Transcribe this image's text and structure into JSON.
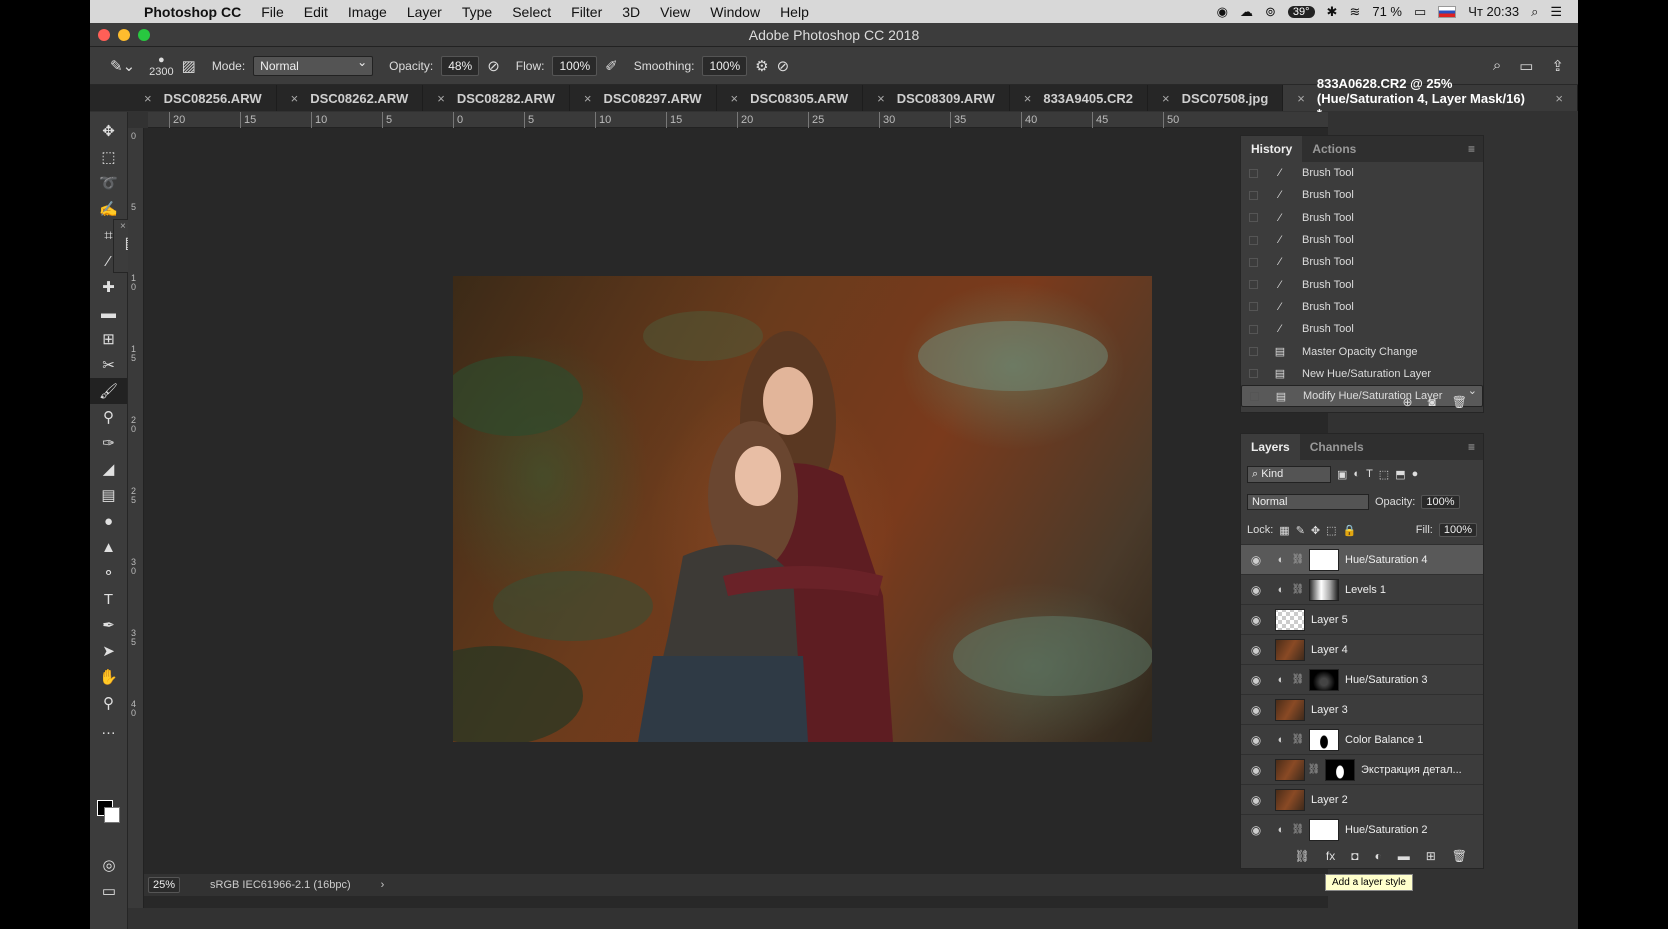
{
  "menubar": {
    "app": "Photoshop CC",
    "items": [
      "File",
      "Edit",
      "Image",
      "Layer",
      "Type",
      "Select",
      "Filter",
      "3D",
      "View",
      "Window",
      "Help"
    ],
    "temp": "39°",
    "battery": "71 %",
    "clock": "Чт 20:33"
  },
  "window": {
    "title": "Adobe Photoshop CC 2018"
  },
  "options": {
    "brush_size": "2300",
    "mode_label": "Mode:",
    "mode_value": "Normal",
    "opacity_label": "Opacity:",
    "opacity_value": "48%",
    "flow_label": "Flow:",
    "flow_value": "100%",
    "smoothing_label": "Smoothing:",
    "smoothing_value": "100%"
  },
  "tabs": [
    "DSC08256.ARW",
    "DSC08262.ARW",
    "DSC08282.ARW",
    "DSC08297.ARW",
    "DSC08305.ARW",
    "DSC08309.ARW",
    "833A9405.CR2",
    "DSC07508.jpg",
    "833A0628.CR2 @ 25% (Hue/Saturation 4, Layer Mask/16) *"
  ],
  "ruler_top": [
    "20",
    "15",
    "10",
    "5",
    "0",
    "5",
    "10",
    "15",
    "20",
    "25",
    "30",
    "35",
    "40",
    "45",
    "50"
  ],
  "ruler_left": [
    "0",
    "5",
    "1\n0",
    "1\n5",
    "2\n0",
    "2\n5",
    "3\n0",
    "3\n5",
    "4\n0"
  ],
  "status": {
    "zoom": "25%",
    "profile": "sRGB IEC61966-2.1 (16bpc)"
  },
  "history": {
    "tabs": [
      "History",
      "Actions"
    ],
    "items": [
      {
        "label": "Brush Tool",
        "icon": "brush-icon"
      },
      {
        "label": "Brush Tool",
        "icon": "brush-icon"
      },
      {
        "label": "Brush Tool",
        "icon": "brush-icon"
      },
      {
        "label": "Brush Tool",
        "icon": "brush-icon"
      },
      {
        "label": "Brush Tool",
        "icon": "brush-icon"
      },
      {
        "label": "Brush Tool",
        "icon": "brush-icon"
      },
      {
        "label": "Brush Tool",
        "icon": "brush-icon"
      },
      {
        "label": "Brush Tool",
        "icon": "brush-icon"
      },
      {
        "label": "Master Opacity Change",
        "icon": "document-icon"
      },
      {
        "label": "New Hue/Saturation Layer",
        "icon": "document-icon"
      },
      {
        "label": "Modify Hue/Saturation Layer",
        "icon": "document-icon"
      }
    ]
  },
  "layers": {
    "tabs": [
      "Layers",
      "Channels"
    ],
    "kind": "Kind",
    "blend": "Normal",
    "opacity_label": "Opacity:",
    "opacity_value": "100%",
    "lock_label": "Lock:",
    "fill_label": "Fill:",
    "fill_value": "100%",
    "items": [
      {
        "name": "Hue/Saturation 4",
        "kind": "adjustment",
        "thumb": "white"
      },
      {
        "name": "Levels 1",
        "kind": "adjustment",
        "thumb": "levels"
      },
      {
        "name": "Layer 5",
        "kind": "pixel",
        "thumb": "check"
      },
      {
        "name": "Layer 4",
        "kind": "pixel",
        "thumb": "photo"
      },
      {
        "name": "Hue/Saturation 3",
        "kind": "adjustment",
        "thumb": "maskdark"
      },
      {
        "name": "Layer 3",
        "kind": "pixel",
        "thumb": "photo"
      },
      {
        "name": "Color Balance 1",
        "kind": "adjustment",
        "thumb": "maskfig"
      },
      {
        "name": "Экстракция детал...",
        "kind": "pixelmask",
        "thumb": "maskfig2"
      },
      {
        "name": "Layer 2",
        "kind": "pixel",
        "thumb": "photo"
      },
      {
        "name": "Hue/Saturation 2",
        "kind": "adjustment",
        "thumb": "white"
      }
    ],
    "tooltip": "Add a layer style"
  }
}
